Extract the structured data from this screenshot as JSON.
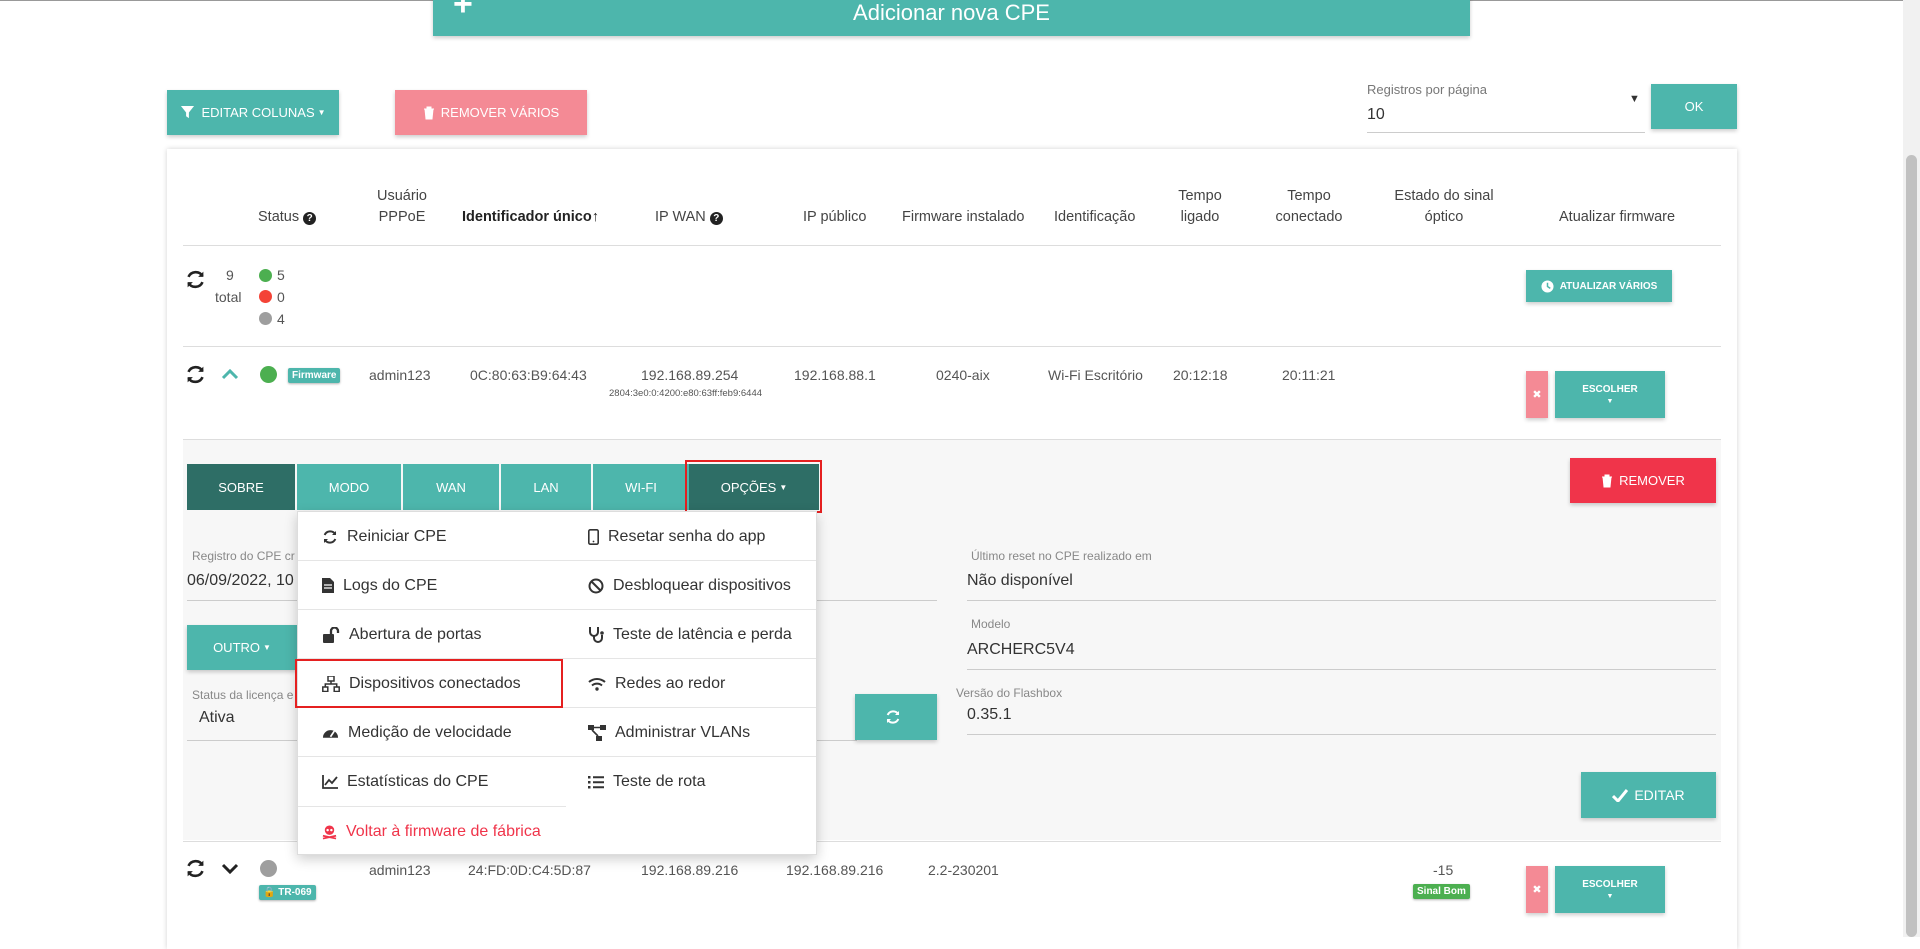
{
  "top": {
    "add_cpe_label": "Adicionar nova CPE"
  },
  "toolbar": {
    "edit_columns": "EDITAR COLUNAS",
    "remove_many": "REMOVER VÁRIOS",
    "records_per_page_label": "Registros por página",
    "records_per_page_value": "10",
    "ok": "OK"
  },
  "table": {
    "headers": {
      "status": "Status",
      "pppoe_line1": "Usuário",
      "pppoe_line2": "PPPoE",
      "unique_id": "Identificador único↑",
      "ip_wan": "IP WAN",
      "ip_public": "IP público",
      "firmware": "Firmware instalado",
      "identification": "Identificação",
      "uptime_line1": "Tempo",
      "uptime_line2": "ligado",
      "conn_line1": "Tempo",
      "conn_line2": "conectado",
      "optical_line1": "Estado do sinal",
      "optical_line2": "óptico",
      "update_fw": "Atualizar firmware"
    },
    "summary": {
      "total_count": "9",
      "total_label": "total",
      "online": "5",
      "offline": "0",
      "unknown": "4",
      "update_many": "ATUALIZAR VÁRIOS"
    },
    "rows": [
      {
        "badge": "Firmware",
        "pppoe": "admin123",
        "unique_id": "0C:80:63:B9:64:43",
        "ip_wan": "192.168.89.254",
        "ipv6": "2804:3e0:0:4200:e80:63ff:feb9:6444",
        "ip_public": "192.168.88.1",
        "firmware": "0240-aix",
        "identification": "Wi-Fi Escritório",
        "uptime": "20:12:18",
        "connected": "20:11:21",
        "choose": "ESCOLHER"
      },
      {
        "badge": "TR-069",
        "pppoe": "admin123",
        "unique_id": "24:FD:0D:C4:5D:87",
        "ip_wan": "192.168.89.216",
        "ip_public": "192.168.89.216",
        "firmware": "2.2-230201",
        "optical": "-15",
        "optical_badge": "Sinal Bom",
        "choose": "ESCOLHER"
      }
    ]
  },
  "details": {
    "tabs": [
      "SOBRE",
      "MODO",
      "WAN",
      "LAN",
      "WI-FI",
      "OPÇÕES"
    ],
    "remove": "REMOVER",
    "reg_label": "Registro do CPE cr",
    "reg_value": "06/09/2022, 10",
    "other": "OUTRO",
    "license_label": "Status da licença e",
    "license_value": "Ativa",
    "last_reset_label": "Último reset no CPE realizado em",
    "last_reset_value": "Não disponível",
    "model_label": "Modelo",
    "model_value": "ARCHERC5V4",
    "flashbox_label": "Versão do Flashbox",
    "flashbox_value": "0.35.1",
    "edit": "EDITAR"
  },
  "menu": {
    "left": [
      "Reiniciar CPE",
      "Logs do CPE",
      "Abertura de portas",
      "Dispositivos conectados",
      "Medição de velocidade",
      "Estatísticas do CPE",
      "Voltar à firmware de fábrica"
    ],
    "right": [
      "Resetar senha do app",
      "Desbloquear dispositivos",
      "Teste de latência e perda",
      "Redes ao redor",
      "Administrar VLANs",
      "Teste de rota"
    ]
  },
  "colors": {
    "accent": "#4db6ac",
    "accent_dark": "#2e6e66",
    "danger": "#f0344a",
    "pink": "#f48a95",
    "highlight": "#e52020"
  }
}
